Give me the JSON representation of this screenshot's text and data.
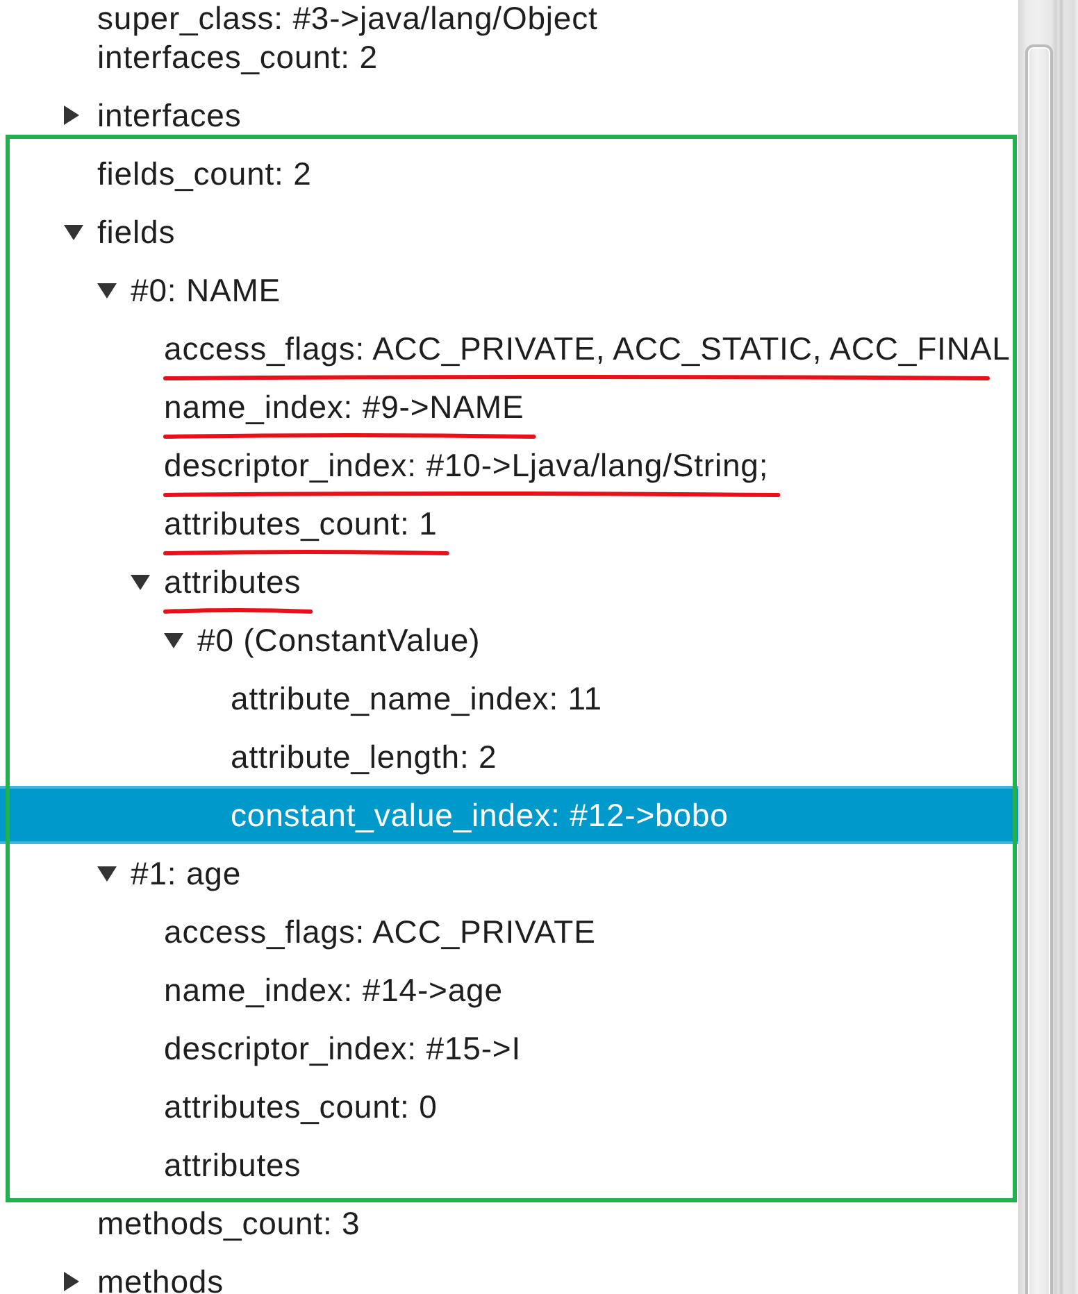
{
  "tree": [
    {
      "label": "super_class: #3->java/lang/Object",
      "kind": "leaf",
      "selected": false,
      "underlined": false,
      "framed": false
    },
    {
      "label": "interfaces_count: 2",
      "kind": "leaf",
      "selected": false,
      "underlined": false,
      "framed": false
    },
    {
      "label": "interfaces",
      "kind": "branch",
      "expanded": false,
      "selected": false,
      "underlined": false,
      "framed": false
    },
    {
      "label": "fields_count: 2",
      "kind": "leaf",
      "selected": false,
      "underlined": false,
      "framed": true
    },
    {
      "label": "fields",
      "kind": "branch",
      "expanded": true,
      "selected": false,
      "underlined": false,
      "framed": true,
      "children": [
        {
          "label": "#0: NAME",
          "kind": "branch",
          "expanded": true,
          "selected": false,
          "underlined": false,
          "children": [
            {
              "label": "access_flags: ACC_PRIVATE, ACC_STATIC, ACC_FINAL",
              "kind": "leaf",
              "selected": false,
              "underlined": true
            },
            {
              "label": "name_index: #9->NAME",
              "kind": "leaf",
              "selected": false,
              "underlined": true
            },
            {
              "label": "descriptor_index: #10->Ljava/lang/String;",
              "kind": "leaf",
              "selected": false,
              "underlined": true
            },
            {
              "label": "attributes_count: 1",
              "kind": "leaf",
              "selected": false,
              "underlined": true
            },
            {
              "label": "attributes",
              "kind": "branch",
              "expanded": true,
              "selected": false,
              "underlined": true,
              "children": [
                {
                  "label": "#0 (ConstantValue)",
                  "kind": "branch",
                  "expanded": true,
                  "selected": false,
                  "underlined": false,
                  "children": [
                    {
                      "label": "attribute_name_index: 11",
                      "kind": "leaf",
                      "selected": false,
                      "underlined": false
                    },
                    {
                      "label": "attribute_length: 2",
                      "kind": "leaf",
                      "selected": false,
                      "underlined": false
                    },
                    {
                      "label": "constant_value_index: #12->bobo",
                      "kind": "leaf",
                      "selected": true,
                      "underlined": false
                    }
                  ]
                }
              ]
            }
          ]
        },
        {
          "label": "#1: age",
          "kind": "branch",
          "expanded": true,
          "selected": false,
          "underlined": false,
          "children": [
            {
              "label": "access_flags: ACC_PRIVATE",
              "kind": "leaf",
              "selected": false,
              "underlined": false
            },
            {
              "label": "name_index: #14->age",
              "kind": "leaf",
              "selected": false,
              "underlined": false
            },
            {
              "label": "descriptor_index: #15->I",
              "kind": "leaf",
              "selected": false,
              "underlined": false
            },
            {
              "label": "attributes_count: 0",
              "kind": "leaf",
              "selected": false,
              "underlined": false
            },
            {
              "label": "attributes",
              "kind": "leaf",
              "selected": false,
              "underlined": false
            }
          ]
        }
      ]
    },
    {
      "label": "methods_count: 3",
      "kind": "leaf",
      "selected": false,
      "underlined": false,
      "framed": false
    },
    {
      "label": "methods",
      "kind": "branch",
      "expanded": false,
      "selected": false,
      "underlined": false,
      "framed": false
    }
  ]
}
